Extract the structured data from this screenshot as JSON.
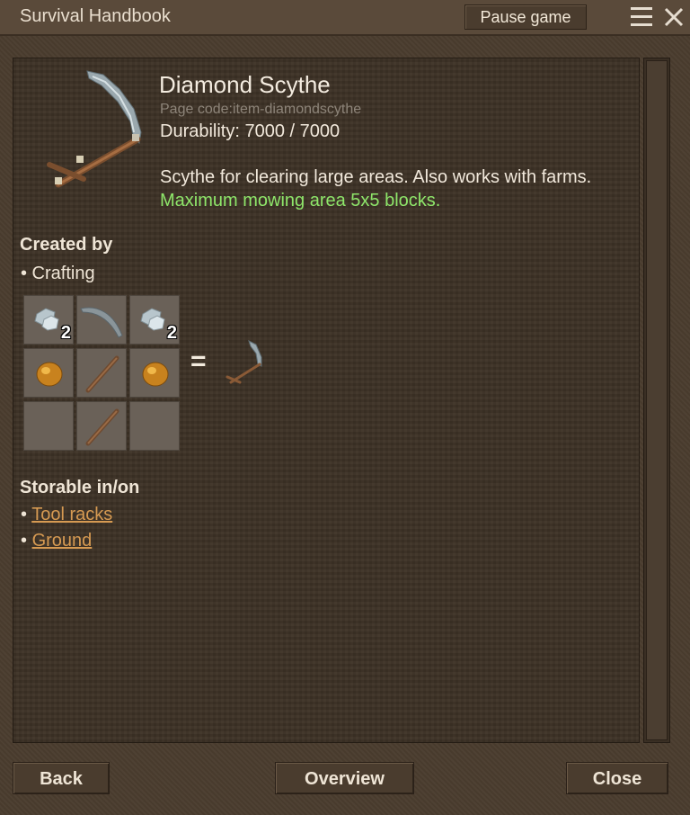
{
  "window": {
    "title": "Survival Handbook"
  },
  "header": {
    "pause_label": "Pause game"
  },
  "item": {
    "name": "Diamond Scythe",
    "page_code": "Page code:item-diamondscythe",
    "durability": "Durability: 7000 / 7000",
    "description": "Scythe for clearing large areas. Also works with farms.",
    "highlight": "Maximum mowing area 5x5 blocks."
  },
  "created_by": {
    "title": "Created by",
    "method": "• Crafting",
    "grid": [
      {
        "icon": "diamond-chunk-icon",
        "qty": "2"
      },
      {
        "icon": "scythe-blade-icon",
        "qty": ""
      },
      {
        "icon": "diamond-chunk-icon",
        "qty": "2"
      },
      {
        "icon": "resin-icon",
        "qty": ""
      },
      {
        "icon": "stick-icon",
        "qty": ""
      },
      {
        "icon": "resin-icon",
        "qty": ""
      },
      {
        "icon": "",
        "qty": ""
      },
      {
        "icon": "stick-icon",
        "qty": ""
      },
      {
        "icon": "",
        "qty": ""
      }
    ],
    "equals": "=",
    "output_icon": "diamond-scythe-icon"
  },
  "storable": {
    "title": "Storable in/on",
    "bullet": "•",
    "items": [
      "Tool racks",
      "Ground"
    ]
  },
  "footer": {
    "back": "Back",
    "overview": "Overview",
    "close": "Close"
  },
  "colors": {
    "highlight": "#8ee66a",
    "link": "#d69a52",
    "background": "#4b3d2f"
  }
}
